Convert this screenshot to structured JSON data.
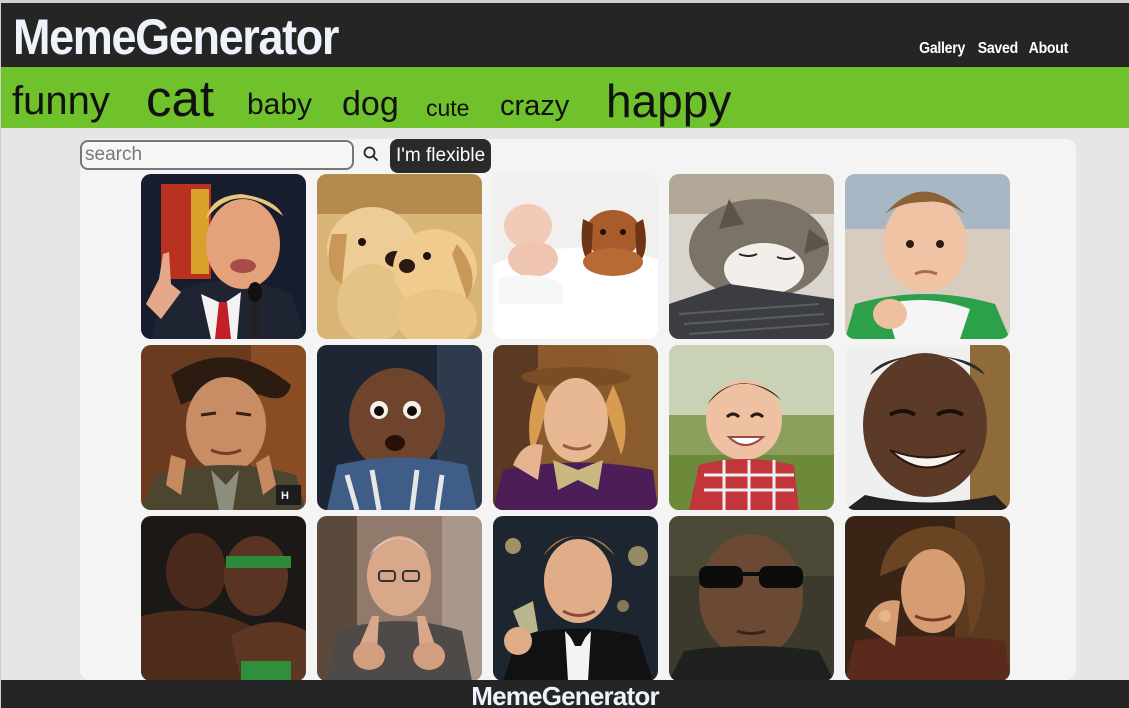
{
  "header": {
    "logo": "MemeGenerator",
    "nav": [
      "Gallery",
      "Saved",
      "About"
    ]
  },
  "keywords": [
    "funny",
    "cat",
    "baby",
    "dog",
    "cute",
    "crazy",
    "happy"
  ],
  "search": {
    "placeholder": "search",
    "flexible_label": "I'm flexible"
  },
  "gallery": {
    "images": [
      "trump-pointing",
      "puppies-kissing",
      "baby-and-dachshund",
      "cat-on-keyboard",
      "success-kid",
      "ancient-aliens-guy",
      "surprised-baby",
      "condescending-wonka",
      "evil-toddler",
      "laughing-obama",
      "basketball-players-kiss",
      "man-pointing-both-hands",
      "leonardo-toast",
      "morpheus-matrix",
      "one-does-not-simply"
    ]
  },
  "footer": {
    "logo": "MemeGenerator"
  },
  "colors": {
    "header_bg": "#252525",
    "keyword_bar": "#6fc22b",
    "page_bg": "#e6e6e6",
    "panel_bg": "#f4f4f4"
  }
}
